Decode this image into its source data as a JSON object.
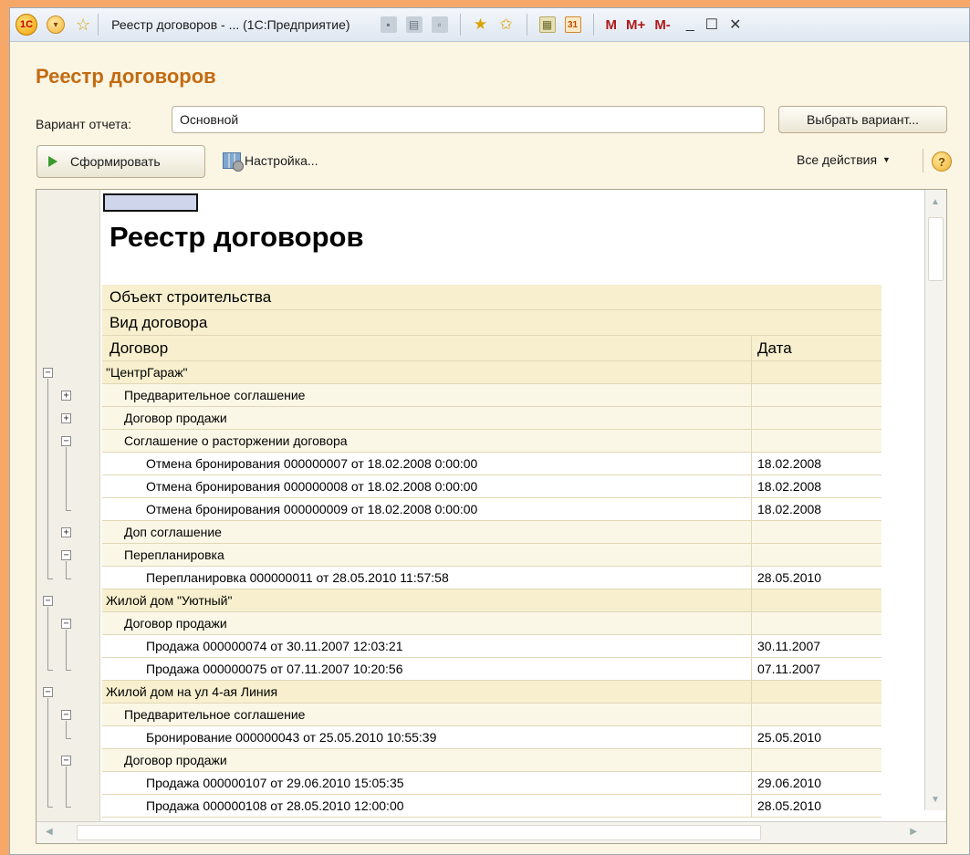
{
  "window": {
    "logo": "1С",
    "title": "Реестр договоров - ... (1С:Предприятие)",
    "m_buttons": [
      "M",
      "M+",
      "M-"
    ],
    "minimize": "_",
    "maximize": "☐",
    "close": "✕"
  },
  "form": {
    "title": "Реестр договоров",
    "variant_label": "Вариант отчета:",
    "variant_value": "Основной",
    "choose_variant": "Выбрать вариант...",
    "generate": "Сформировать",
    "settings": "Настройка...",
    "all_actions": "Все действия",
    "help": "?"
  },
  "report": {
    "title": "Реестр договоров",
    "headers": {
      "object": "Объект строительства",
      "contract_type": "Вид договора",
      "contract": "Договор",
      "date": "Дата"
    },
    "rows": [
      {
        "level": 0,
        "text": "\"ЦентрГараж\"",
        "date": "",
        "toggle": "−"
      },
      {
        "level": 1,
        "text": "Предварительное соглашение",
        "date": "",
        "toggle": "+"
      },
      {
        "level": 1,
        "text": "Договор продажи",
        "date": "",
        "toggle": "+"
      },
      {
        "level": 1,
        "text": "Соглашение о расторжении договора",
        "date": "",
        "toggle": "−"
      },
      {
        "level": 2,
        "text": "Отмена бронирования 000000007 от 18.02.2008 0:00:00",
        "date": "18.02.2008",
        "toggle": ""
      },
      {
        "level": 2,
        "text": "Отмена бронирования 000000008 от 18.02.2008 0:00:00",
        "date": "18.02.2008",
        "toggle": ""
      },
      {
        "level": 2,
        "text": "Отмена бронирования 000000009 от 18.02.2008 0:00:00",
        "date": "18.02.2008",
        "toggle": ""
      },
      {
        "level": 1,
        "text": "Доп соглашение",
        "date": "",
        "toggle": "+"
      },
      {
        "level": 1,
        "text": "Перепланировка",
        "date": "",
        "toggle": "−"
      },
      {
        "level": 2,
        "text": "Перепланировка 000000011 от 28.05.2010 11:57:58",
        "date": "28.05.2010",
        "toggle": ""
      },
      {
        "level": 0,
        "text": "Жилой дом \"Уютный\"",
        "date": "",
        "toggle": "−"
      },
      {
        "level": 1,
        "text": "Договор продажи",
        "date": "",
        "toggle": "−"
      },
      {
        "level": 2,
        "text": "Продажа 000000074 от 30.11.2007 12:03:21",
        "date": "30.11.2007",
        "toggle": ""
      },
      {
        "level": 2,
        "text": "Продажа 000000075 от 07.11.2007 10:20:56",
        "date": "07.11.2007",
        "toggle": ""
      },
      {
        "level": 0,
        "text": "Жилой дом на ул 4-ая Линия",
        "date": "",
        "toggle": "−"
      },
      {
        "level": 1,
        "text": "Предварительное соглашение",
        "date": "",
        "toggle": "−"
      },
      {
        "level": 2,
        "text": "Бронирование 000000043 от 25.05.2010 10:55:39",
        "date": "25.05.2010",
        "toggle": ""
      },
      {
        "level": 1,
        "text": "Договор продажи",
        "date": "",
        "toggle": "−"
      },
      {
        "level": 2,
        "text": "Продажа 000000107 от 29.06.2010 15:05:35",
        "date": "29.06.2010",
        "toggle": ""
      },
      {
        "level": 2,
        "text": "Продажа 000000108 от 28.05.2010 12:00:00",
        "date": "28.05.2010",
        "toggle": ""
      }
    ]
  }
}
